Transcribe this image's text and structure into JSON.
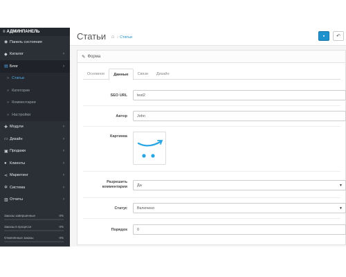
{
  "sidebar": {
    "brand": "АДМИНПАНЕЛЬ",
    "items": [
      {
        "label": "Панель состояния",
        "icon": "dashboard-icon",
        "has_children": false
      },
      {
        "label": "Каталог",
        "icon": "tag-icon",
        "has_children": true
      },
      {
        "label": "Блог",
        "icon": "list-icon",
        "has_children": true,
        "active": true
      }
    ],
    "subitems": [
      {
        "label": "Статьи",
        "active": true
      },
      {
        "label": "Категории"
      },
      {
        "label": "Комментарии"
      },
      {
        "label": "Настройки"
      }
    ],
    "items_after": [
      {
        "label": "Модули",
        "icon": "puzzle-icon"
      },
      {
        "label": "Дизайн",
        "icon": "monitor-icon"
      },
      {
        "label": "Продажи",
        "icon": "cart-icon"
      },
      {
        "label": "Клиенты",
        "icon": "user-icon"
      },
      {
        "label": "Маркетинг",
        "icon": "share-icon"
      },
      {
        "label": "Система",
        "icon": "gear-icon"
      },
      {
        "label": "Отчеты",
        "icon": "bar-chart-icon"
      }
    ],
    "progress": [
      {
        "label": "Заказы завершенные",
        "value": "0%"
      },
      {
        "label": "Заказы в процессе",
        "value": "0%"
      },
      {
        "label": "Отменённые заказы",
        "value": "0%"
      }
    ]
  },
  "header": {
    "title": "Статьи",
    "breadcrumb_link": "Статьи",
    "breadcrumb_separator": "›"
  },
  "panel": {
    "heading": "Форма"
  },
  "tabs": [
    "Основное",
    "Данные",
    "Связи",
    "Дизайн"
  ],
  "active_tab": "Данные",
  "form": {
    "seo_label": "SEO URL",
    "seo_value": "test2",
    "author_label": "Автор",
    "author_value": "John",
    "image_label": "Картинка",
    "comments_label_line1": "Разрешить",
    "comments_label_line2": "комментарии",
    "comments_value": "Да",
    "status_label": "Статус",
    "status_value": "Включено",
    "order_label": "Порядок",
    "order_value": "0"
  },
  "colors": {
    "accent": "#1e91cf",
    "sidebar_bg": "#2b2f36",
    "active_sub": "#4fb0ea"
  }
}
